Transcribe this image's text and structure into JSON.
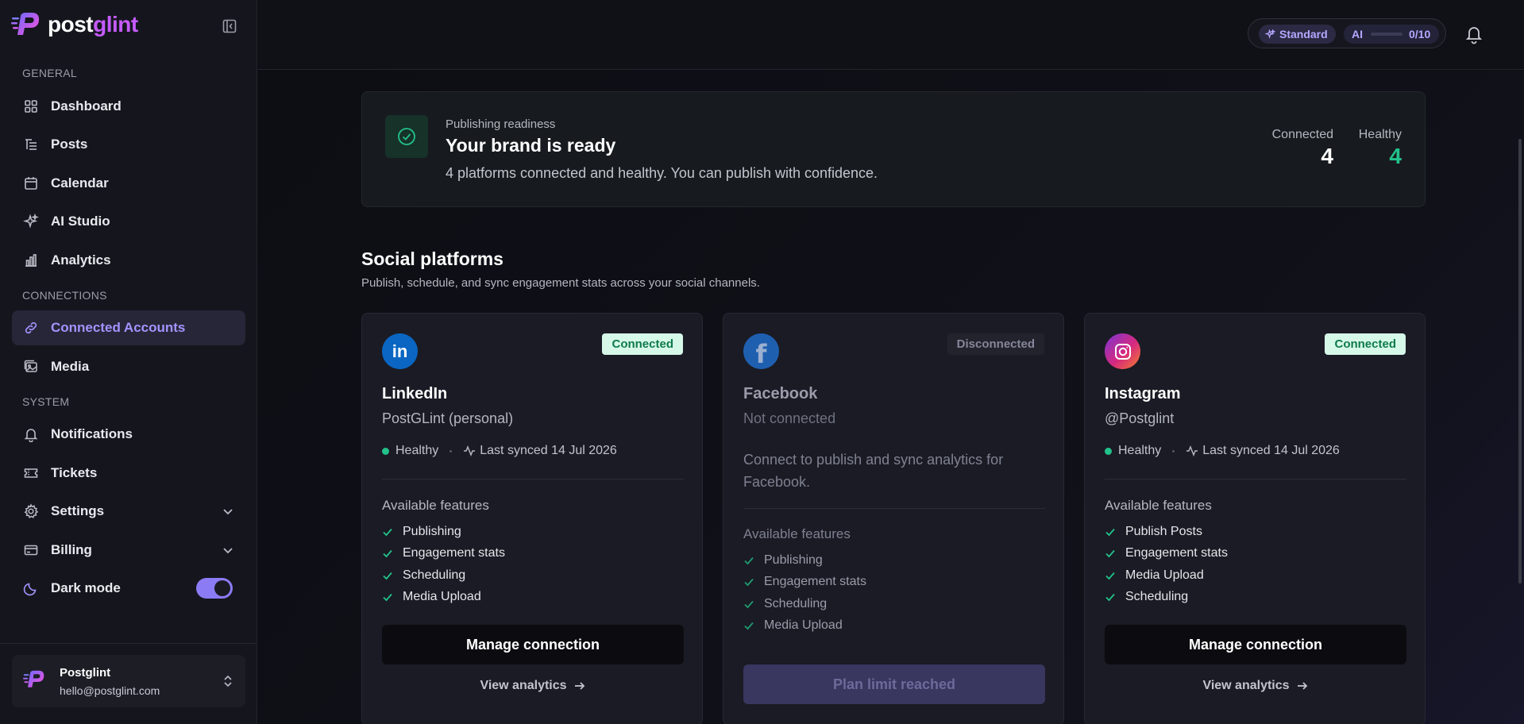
{
  "brand": {
    "name_part1": "post",
    "name_part2": "glint"
  },
  "sidebar": {
    "sections": {
      "general": "GENERAL",
      "connections": "CONNECTIONS",
      "system": "SYSTEM"
    },
    "items": {
      "dashboard": "Dashboard",
      "posts": "Posts",
      "calendar": "Calendar",
      "ai_studio": "AI Studio",
      "analytics": "Analytics",
      "connected_accounts": "Connected Accounts",
      "media": "Media",
      "notifications": "Notifications",
      "tickets": "Tickets",
      "settings": "Settings",
      "billing": "Billing",
      "dark_mode": "Dark mode"
    },
    "dark_mode_on": true,
    "user": {
      "name": "Postglint",
      "email": "hello@postglint.com"
    }
  },
  "topbar": {
    "plan": "Standard",
    "ai_label": "AI",
    "ai_usage": "0/10",
    "ai_used": 0,
    "ai_limit": 10
  },
  "readiness": {
    "eyebrow": "Publishing readiness",
    "title": "Your brand is ready",
    "description": "4 platforms connected and healthy. You can publish with confidence.",
    "connected_label": "Connected",
    "connected_value": "4",
    "healthy_label": "Healthy",
    "healthy_value": "4"
  },
  "platforms_section": {
    "title": "Social platforms",
    "subtitle": "Publish, schedule, and sync engagement stats across your social channels."
  },
  "platforms": [
    {
      "name": "LinkedIn",
      "status": "Connected",
      "handle": "PostGLint (personal)",
      "health": "Healthy",
      "synced": "Last synced 14 Jul 2026",
      "features_title": "Available features",
      "features": [
        "Publishing",
        "Engagement stats",
        "Scheduling",
        "Media Upload"
      ],
      "primary_action": "Manage connection",
      "secondary_action": "View analytics",
      "logo_text": "in"
    },
    {
      "name": "Facebook",
      "status": "Disconnected",
      "handle": "Not connected",
      "description": "Connect to publish and sync analytics for Facebook.",
      "features_title": "Available features",
      "features": [
        "Publishing",
        "Engagement stats",
        "Scheduling",
        "Media Upload"
      ],
      "primary_action": "Plan limit reached",
      "logo_text": "f"
    },
    {
      "name": "Instagram",
      "status": "Connected",
      "handle": "@Postglint",
      "health": "Healthy",
      "synced": "Last synced 14 Jul 2026",
      "features_title": "Available features",
      "features": [
        "Publish Posts",
        "Engagement stats",
        "Media Upload",
        "Scheduling"
      ],
      "primary_action": "Manage connection",
      "secondary_action": "View analytics"
    }
  ],
  "colors": {
    "accent": "#8b7cf6",
    "success": "#22c28a",
    "linkedin": "#0a66c2",
    "facebook": "#1f5fb0"
  }
}
